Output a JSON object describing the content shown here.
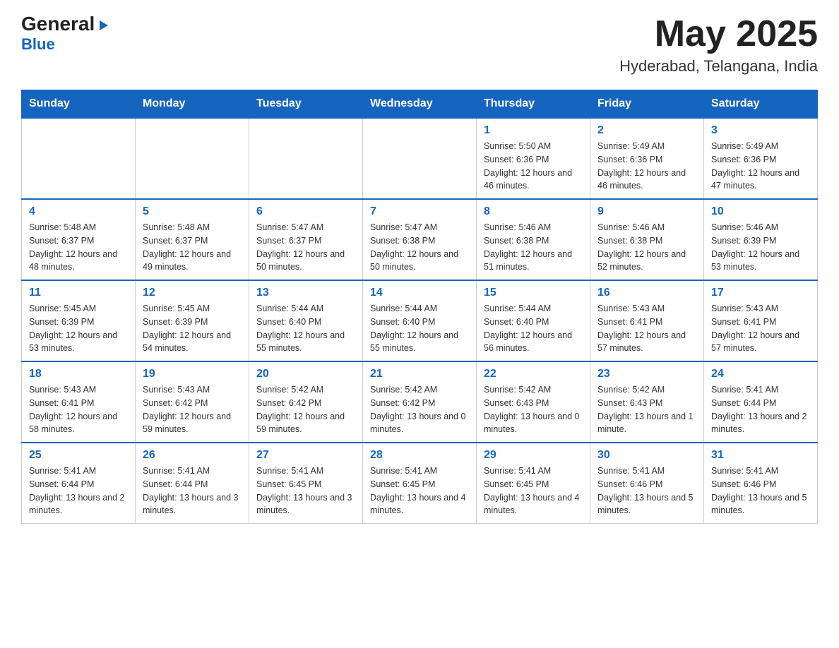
{
  "header": {
    "logo_general": "General",
    "logo_blue": "Blue",
    "month_title": "May 2025",
    "location": "Hyderabad, Telangana, India"
  },
  "days_of_week": [
    "Sunday",
    "Monday",
    "Tuesday",
    "Wednesday",
    "Thursday",
    "Friday",
    "Saturday"
  ],
  "weeks": [
    [
      {
        "day": "",
        "info": ""
      },
      {
        "day": "",
        "info": ""
      },
      {
        "day": "",
        "info": ""
      },
      {
        "day": "",
        "info": ""
      },
      {
        "day": "1",
        "info": "Sunrise: 5:50 AM\nSunset: 6:36 PM\nDaylight: 12 hours and 46 minutes."
      },
      {
        "day": "2",
        "info": "Sunrise: 5:49 AM\nSunset: 6:36 PM\nDaylight: 12 hours and 46 minutes."
      },
      {
        "day": "3",
        "info": "Sunrise: 5:49 AM\nSunset: 6:36 PM\nDaylight: 12 hours and 47 minutes."
      }
    ],
    [
      {
        "day": "4",
        "info": "Sunrise: 5:48 AM\nSunset: 6:37 PM\nDaylight: 12 hours and 48 minutes."
      },
      {
        "day": "5",
        "info": "Sunrise: 5:48 AM\nSunset: 6:37 PM\nDaylight: 12 hours and 49 minutes."
      },
      {
        "day": "6",
        "info": "Sunrise: 5:47 AM\nSunset: 6:37 PM\nDaylight: 12 hours and 50 minutes."
      },
      {
        "day": "7",
        "info": "Sunrise: 5:47 AM\nSunset: 6:38 PM\nDaylight: 12 hours and 50 minutes."
      },
      {
        "day": "8",
        "info": "Sunrise: 5:46 AM\nSunset: 6:38 PM\nDaylight: 12 hours and 51 minutes."
      },
      {
        "day": "9",
        "info": "Sunrise: 5:46 AM\nSunset: 6:38 PM\nDaylight: 12 hours and 52 minutes."
      },
      {
        "day": "10",
        "info": "Sunrise: 5:46 AM\nSunset: 6:39 PM\nDaylight: 12 hours and 53 minutes."
      }
    ],
    [
      {
        "day": "11",
        "info": "Sunrise: 5:45 AM\nSunset: 6:39 PM\nDaylight: 12 hours and 53 minutes."
      },
      {
        "day": "12",
        "info": "Sunrise: 5:45 AM\nSunset: 6:39 PM\nDaylight: 12 hours and 54 minutes."
      },
      {
        "day": "13",
        "info": "Sunrise: 5:44 AM\nSunset: 6:40 PM\nDaylight: 12 hours and 55 minutes."
      },
      {
        "day": "14",
        "info": "Sunrise: 5:44 AM\nSunset: 6:40 PM\nDaylight: 12 hours and 55 minutes."
      },
      {
        "day": "15",
        "info": "Sunrise: 5:44 AM\nSunset: 6:40 PM\nDaylight: 12 hours and 56 minutes."
      },
      {
        "day": "16",
        "info": "Sunrise: 5:43 AM\nSunset: 6:41 PM\nDaylight: 12 hours and 57 minutes."
      },
      {
        "day": "17",
        "info": "Sunrise: 5:43 AM\nSunset: 6:41 PM\nDaylight: 12 hours and 57 minutes."
      }
    ],
    [
      {
        "day": "18",
        "info": "Sunrise: 5:43 AM\nSunset: 6:41 PM\nDaylight: 12 hours and 58 minutes."
      },
      {
        "day": "19",
        "info": "Sunrise: 5:43 AM\nSunset: 6:42 PM\nDaylight: 12 hours and 59 minutes."
      },
      {
        "day": "20",
        "info": "Sunrise: 5:42 AM\nSunset: 6:42 PM\nDaylight: 12 hours and 59 minutes."
      },
      {
        "day": "21",
        "info": "Sunrise: 5:42 AM\nSunset: 6:42 PM\nDaylight: 13 hours and 0 minutes."
      },
      {
        "day": "22",
        "info": "Sunrise: 5:42 AM\nSunset: 6:43 PM\nDaylight: 13 hours and 0 minutes."
      },
      {
        "day": "23",
        "info": "Sunrise: 5:42 AM\nSunset: 6:43 PM\nDaylight: 13 hours and 1 minute."
      },
      {
        "day": "24",
        "info": "Sunrise: 5:41 AM\nSunset: 6:44 PM\nDaylight: 13 hours and 2 minutes."
      }
    ],
    [
      {
        "day": "25",
        "info": "Sunrise: 5:41 AM\nSunset: 6:44 PM\nDaylight: 13 hours and 2 minutes."
      },
      {
        "day": "26",
        "info": "Sunrise: 5:41 AM\nSunset: 6:44 PM\nDaylight: 13 hours and 3 minutes."
      },
      {
        "day": "27",
        "info": "Sunrise: 5:41 AM\nSunset: 6:45 PM\nDaylight: 13 hours and 3 minutes."
      },
      {
        "day": "28",
        "info": "Sunrise: 5:41 AM\nSunset: 6:45 PM\nDaylight: 13 hours and 4 minutes."
      },
      {
        "day": "29",
        "info": "Sunrise: 5:41 AM\nSunset: 6:45 PM\nDaylight: 13 hours and 4 minutes."
      },
      {
        "day": "30",
        "info": "Sunrise: 5:41 AM\nSunset: 6:46 PM\nDaylight: 13 hours and 5 minutes."
      },
      {
        "day": "31",
        "info": "Sunrise: 5:41 AM\nSunset: 6:46 PM\nDaylight: 13 hours and 5 minutes."
      }
    ]
  ]
}
